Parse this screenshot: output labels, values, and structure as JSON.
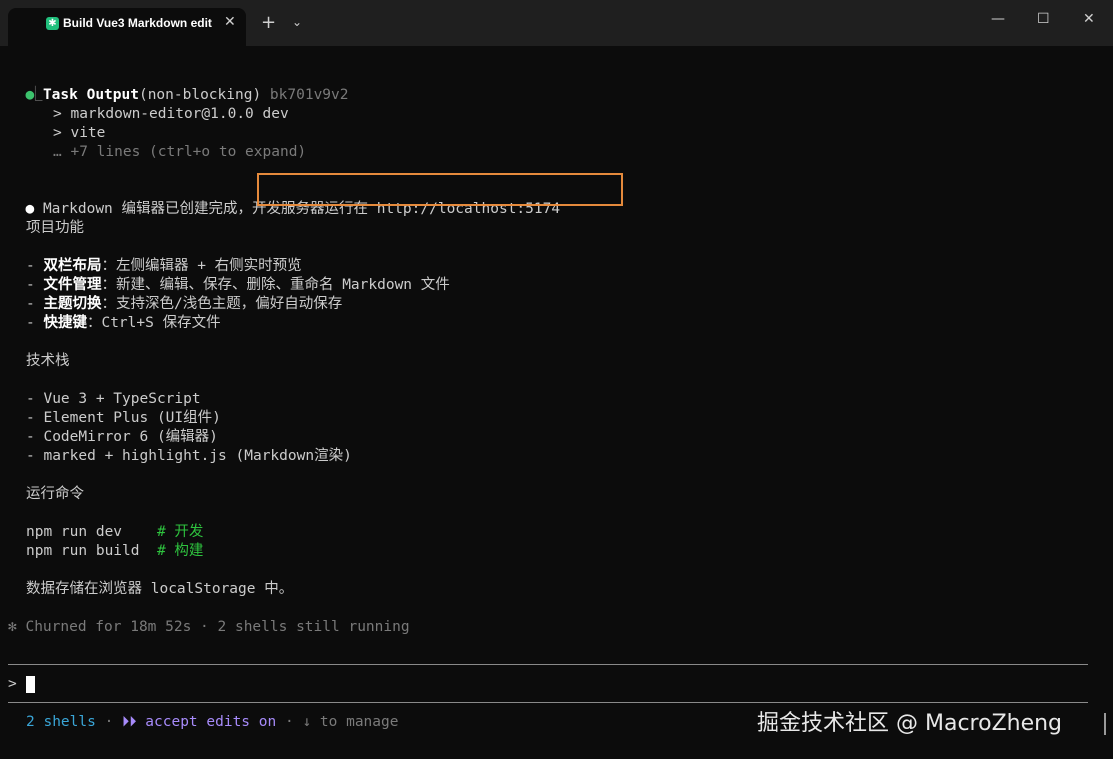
{
  "window": {
    "tab_title": "Build Vue3 Markdown edit",
    "close_glyph": "✕",
    "new_tab_glyph": "+",
    "dropdown_glyph": "⌄",
    "minimize_glyph": "—",
    "maximize_glyph": "☐",
    "close_window_glyph": "✕"
  },
  "task": {
    "bullet": "●",
    "name": "Task Output",
    "mode": "(non-blocking)",
    "id": "bk701v9v2",
    "tree": "⎿",
    "out1": "> markdown-editor@1.0.0 dev",
    "out2": "> vite",
    "more": "… +7 lines (ctrl+o to expand)"
  },
  "summary": {
    "bullet": "●",
    "part1": "Markdown 编辑器已创建完成，",
    "part2": "开发服务器运行在 http://localhost:5174"
  },
  "features": {
    "heading": "项目功能",
    "items": [
      {
        "label": "双栏布局",
        "text": "：左侧编辑器 + 右侧实时预览"
      },
      {
        "label": "文件管理",
        "text": "：新建、编辑、保存、删除、重命名 Markdown 文件"
      },
      {
        "label": "主题切换",
        "text": "：支持深色/浅色主题，偏好自动保存"
      },
      {
        "label": "快捷键",
        "text": "：Ctrl+S 保存文件"
      }
    ]
  },
  "stack": {
    "heading": "技术栈",
    "items": [
      "- Vue 3 + TypeScript",
      "- Element Plus (UI组件)",
      "- CodeMirror 6 (编辑器)",
      "- marked + highlight.js (Markdown渲染)"
    ]
  },
  "commands": {
    "heading": "运行命令",
    "cmd1": "npm run dev    ",
    "cmt1": "# 开发",
    "cmd2": "npm run build  ",
    "cmt2": "# 构建"
  },
  "storage_note": "数据存储在浏览器 localStorage 中。",
  "status_line": "✻ Churned for 18m 52s · 2 shells still running",
  "prompt": {
    "symbol": ">"
  },
  "footer": {
    "shells": "2 shells",
    "sep1": " · ",
    "accept_icon": "⏵⏵",
    "accept_text": " accept edits on",
    "sep2": " · ",
    "manage": "↓ to manage"
  },
  "watermark": "掘金技术社区 @ MacroZheng",
  "colors": {
    "background": "#0c0c0c",
    "highlight_border": "#e58a3c",
    "green": "#2ec23e",
    "blue": "#3aa6d8",
    "purple": "#a78bfa"
  }
}
